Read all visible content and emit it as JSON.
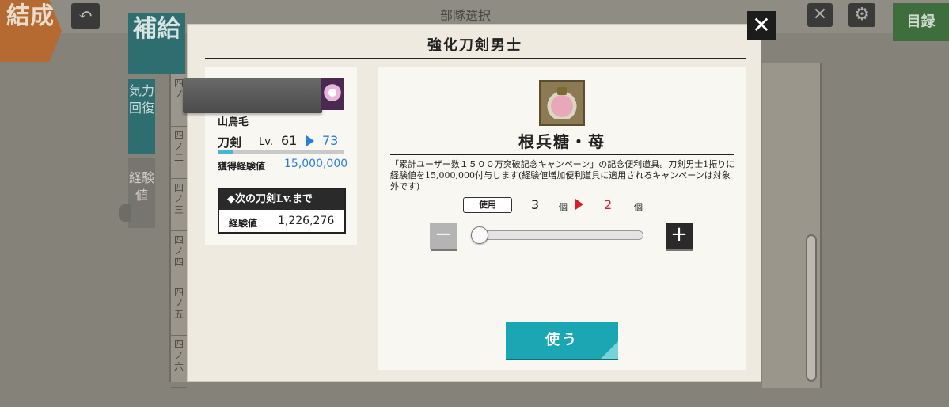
{
  "background": {
    "formation_tab": "結成",
    "supply_tab": "補給",
    "screen_title": "部隊選択",
    "side_tab_energy": "気力回復",
    "side_tab_exp": "経験値",
    "list_cells": [
      "四ノ一",
      "四ノ二",
      "四ノ三",
      "四ノ四",
      "四ノ五",
      "四ノ六"
    ],
    "catalog_button": "目録"
  },
  "modal": {
    "title": "強化刀剣男士",
    "character": {
      "name": "山鳥毛",
      "class": "刀剣",
      "level_label": "Lv.",
      "level_from": "61",
      "level_to": "73",
      "exp_progress": 0.12,
      "gain_label": "獲得経験値",
      "gain_value": "15,000,000",
      "next_heading": "◆次の刀剣Lv.まで",
      "next_label": "経験値",
      "next_value": "1,226,276"
    },
    "item": {
      "icon": "sugar-jar-icon",
      "name": "根兵糖・苺",
      "description": "「累計ユーザー数１５００万突破記念キャンペーン」の記念便利道具。刀剣男士1振りに経験値を15,000,000付与します(経験値増加便利道具に適用されるキャンペーンは対象外です)",
      "use_label": "使用",
      "count_from": "3",
      "count_to": "2",
      "unit": "個",
      "slider_value": 0,
      "minus_symbol": "−",
      "plus_symbol": "+",
      "use_button": "使う"
    }
  },
  "colors": {
    "accent_teal": "#1aa7b3",
    "level_blue": "#2a7fd8",
    "count_red": "#d81e2a"
  }
}
